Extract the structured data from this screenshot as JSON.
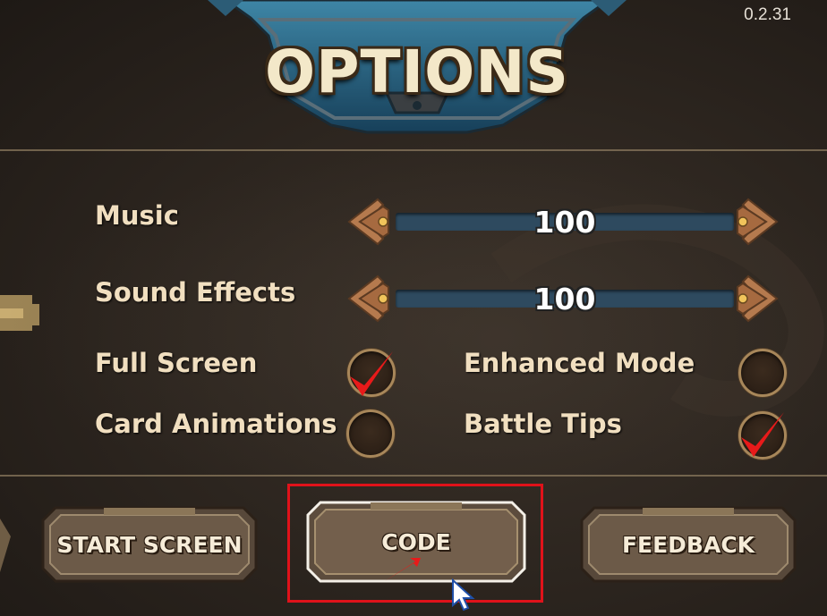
{
  "version": "0.2.31",
  "title": "OPTIONS",
  "sliders": [
    {
      "label": "Music",
      "value": "100"
    },
    {
      "label": "Sound Effects",
      "value": "100"
    }
  ],
  "toggles": [
    {
      "label": "Full Screen",
      "checked": true
    },
    {
      "label": "Enhanced Mode",
      "checked": false
    },
    {
      "label": "Card Animations",
      "checked": false
    },
    {
      "label": "Battle Tips",
      "checked": true
    }
  ],
  "buttons": {
    "start_screen": "START SCREEN",
    "code": "CODE",
    "feedback": "FEEDBACK"
  },
  "colors": {
    "highlight_box": "#e0121a",
    "check_mark": "#e81a1a",
    "slider_track": "#2e4a5f",
    "label_text": "#f1dfc0"
  },
  "icons": [
    "left-arrow-icon",
    "right-arrow-icon",
    "check-icon",
    "mouse-cursor-icon"
  ]
}
